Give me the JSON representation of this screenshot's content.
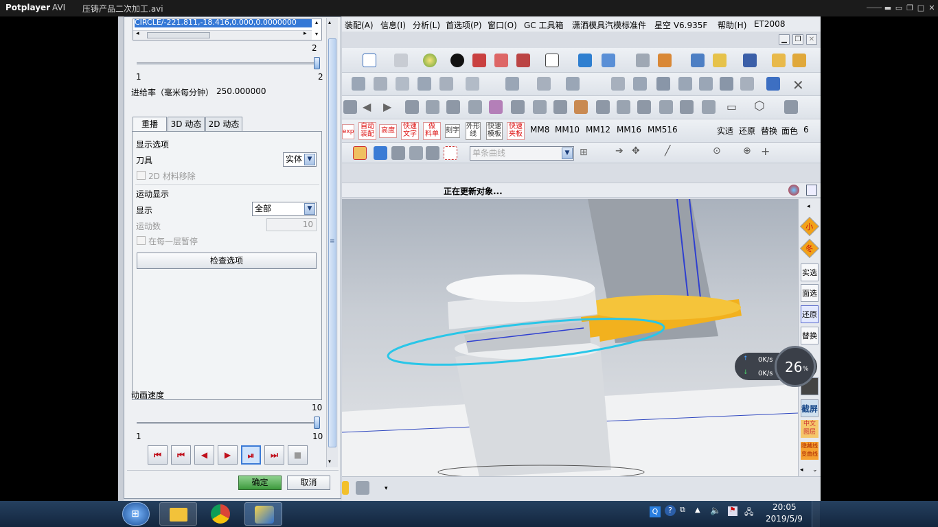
{
  "player": {
    "app_name": "Potplayer",
    "format": "AVI",
    "file_title": "压铸产品二次加工.avi"
  },
  "menu": [
    "装配(A)",
    "信息(I)",
    "分析(L)",
    "首选项(P)",
    "窗口(O)",
    "GC 工具箱",
    "潇洒模具汽模标准件",
    "星空 V6.935F",
    "帮助(H)",
    "ET2008"
  ],
  "toolbar": {
    "red_tags": [
      "exp",
      "自动\n装配",
      "高度",
      "快速\n文字",
      "做\n料单",
      "刻字",
      "外形\n线",
      "快速\n模板",
      "快速\n夹板"
    ],
    "mm_labels": [
      "MM8",
      "MM10",
      "MM12",
      "MM16",
      "MM516"
    ],
    "right_labels": [
      "实适",
      "还原",
      "替换",
      "面色",
      "6"
    ],
    "curve_combo": "单条曲线"
  },
  "status_text": "正在更新对象...",
  "right_buttons": [
    "实选",
    "面选",
    "还原",
    "替换",
    "截屏",
    "中文图层",
    "隐藏线变曲线"
  ],
  "right_icons": [
    "小",
    "冬"
  ],
  "dialog": {
    "path_list_item": "CIRCLE/-221.811,-18.416,0.000,0.0000000",
    "top_slider": {
      "max_label": "2",
      "min_label": "1",
      "right_label": "2",
      "value_fraction": 1.0
    },
    "feed_rate_label": "进给率（毫米每分钟）",
    "feed_rate_value": "250.000000",
    "tabs": [
      "重播",
      "3D 动态",
      "2D 动态"
    ],
    "display_options_title": "显示选项",
    "tool_label": "刀具",
    "tool_value": "实体",
    "material_remove_label": "2D 材料移除",
    "motion_display_title": "运动显示",
    "display_label": "显示",
    "display_value": "全部",
    "motion_count_label": "运动数",
    "motion_count_value": "10",
    "pause_each_layer_label": "在每一层暂停",
    "check_options_button": "检查选项",
    "anim_speed_label": "动画速度",
    "speed_slider": {
      "max_label": "10",
      "min_label": "1",
      "right_label": "10",
      "value_fraction": 1.0
    },
    "playback_buttons": [
      "⏮",
      "⏮",
      "◀",
      "▶",
      "⏯",
      "⏭",
      "■"
    ],
    "ok_button": "确定",
    "cancel_button": "取消"
  },
  "net_widget": {
    "up": "0K/s",
    "down": "0K/s",
    "percent": "26",
    "percent_unit": "%"
  },
  "clock": {
    "time": "20:05",
    "date": "2019/5/9"
  },
  "colors": {
    "accent_yellow": "#f2b11e",
    "cyan_ring": "#29c6e8",
    "taskbar": "#1b3350",
    "ok_green": "#3d9a3d"
  }
}
